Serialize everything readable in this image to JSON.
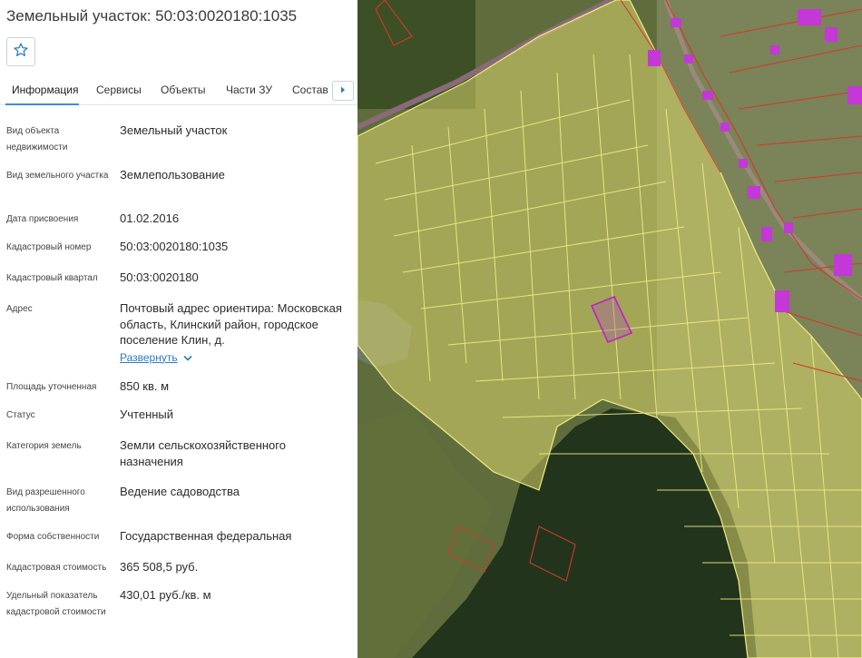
{
  "header": {
    "title": "Земельный участок: 50:03:0020180:1035"
  },
  "icons": {
    "favorite": "star-icon",
    "next_tab": "chevron-right-icon",
    "expand": "chevron-down-icon"
  },
  "colors": {
    "accent": "#3b8fcf",
    "link": "#2a7bc0",
    "parcel_fill": "#d9d56b",
    "parcel_line": "#f0ec86",
    "selected_parcel": "#c01fc8",
    "building": "#c338d6",
    "red_boundary": "#d2392c"
  },
  "tabs": [
    {
      "label": "Информация"
    },
    {
      "label": "Сервисы"
    },
    {
      "label": "Объекты"
    },
    {
      "label": "Части ЗУ"
    },
    {
      "label": "Состав ЕЗП"
    }
  ],
  "fields": [
    {
      "label": "Вид объекта недвижимости",
      "value": "Земельный участок"
    },
    {
      "label": "Вид земельного участка",
      "value": "Землепользование"
    },
    {
      "label": "Дата присвоения",
      "value": "01.02.2016"
    },
    {
      "label": "Кадастровый номер",
      "value": "50:03:0020180:1035"
    },
    {
      "label": "Кадастровый квартал",
      "value": "50:03:0020180"
    },
    {
      "label": "Адрес",
      "value": "Почтовый адрес ориентира: Московская область, Клинский район, городское поселение Клин, д."
    },
    {
      "label": "Площадь уточненная",
      "value": "850 кв. м"
    },
    {
      "label": "Статус",
      "value": "Учтенный"
    },
    {
      "label": "Категория земель",
      "value": "Земли сельскохозяйственного назначения"
    },
    {
      "label": "Вид разрешенного использования",
      "value": "Ведение садоводства"
    },
    {
      "label": "Форма собственности",
      "value": "Государственная федеральная"
    },
    {
      "label": "Кадастровая стоимость",
      "value": "365 508,5 руб."
    },
    {
      "label": "Удельный показатель кадастровой стоимости",
      "value": "430,01 руб./кв. м"
    }
  ],
  "address_expand_label": "Развернуть"
}
